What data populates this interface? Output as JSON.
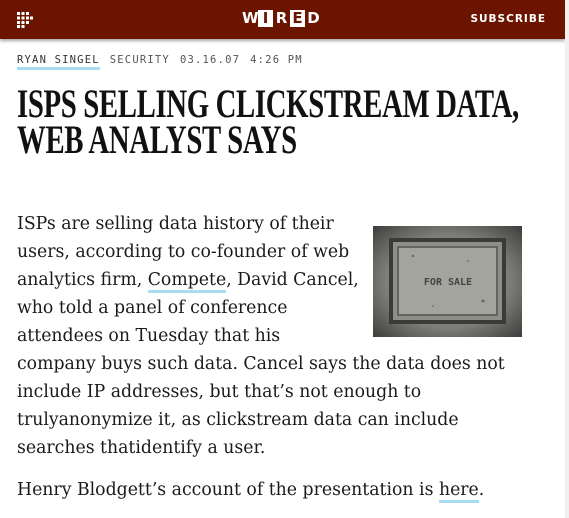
{
  "header": {
    "logo_letters": [
      "W",
      "I",
      "R",
      "E",
      "D"
    ],
    "subscribe_label": "SUBSCRIBE",
    "menu_icon": "grid-menu-icon",
    "brand_color": "#6b1400"
  },
  "byline": {
    "author": "RYAN SINGEL",
    "category": "SECURITY",
    "date": "03.16.07",
    "time": "4:26 PM"
  },
  "headline": "ISPS SELLING CLICKSTREAM DATA, WEB ANALYST SAYS",
  "body": {
    "p1_before": "ISPs are selling data history of their users, according to co-founder of web analytics firm, ",
    "p1_link": "Compete",
    "p1_after": ", David Cancel, who told a panel of conference attendees on Tuesday that his company buys such data. Cancel says the data does not include IP addresses, but that’s not enough to trulyanonymize it, as clickstream data can include searches thatidentify a user.",
    "p2_before": "Henry Blodgett’s account of the presentation is ",
    "p2_link": "here",
    "p2_after": "."
  },
  "photo": {
    "sign_text": "FOR SALE",
    "icon": "manhole-cover-photo"
  },
  "colors": {
    "link_underline": "#a8dcf2"
  }
}
